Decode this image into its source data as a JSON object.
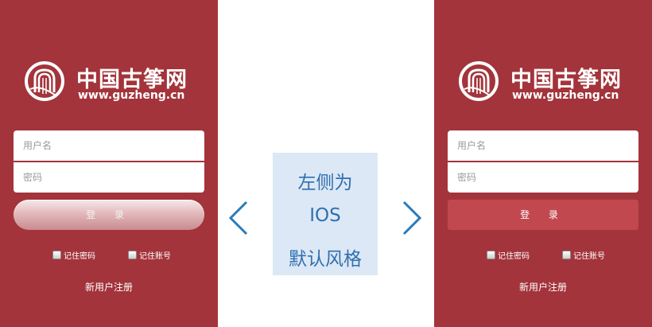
{
  "brand": {
    "name": "中国古筝网",
    "url": "www.guzheng.cn"
  },
  "login_form": {
    "username_placeholder": "用户名",
    "password_placeholder": "密码",
    "login_label": "登 录",
    "remember_password": "记住密码",
    "remember_account": "记住账号",
    "register_link": "新用户注册"
  },
  "caption": {
    "line1": "左侧为",
    "line2": "IOS",
    "line3": "默认风格"
  },
  "colors": {
    "background_red": "#a3343b",
    "flat_button": "#c1484f",
    "caption_bg": "#dce8f5",
    "caption_text": "#2f6fb0",
    "arrow": "#2b7bb9"
  },
  "icons": {
    "prev": "chevron-left-icon",
    "next": "chevron-right-icon",
    "logo": "guzheng-logo-icon"
  }
}
